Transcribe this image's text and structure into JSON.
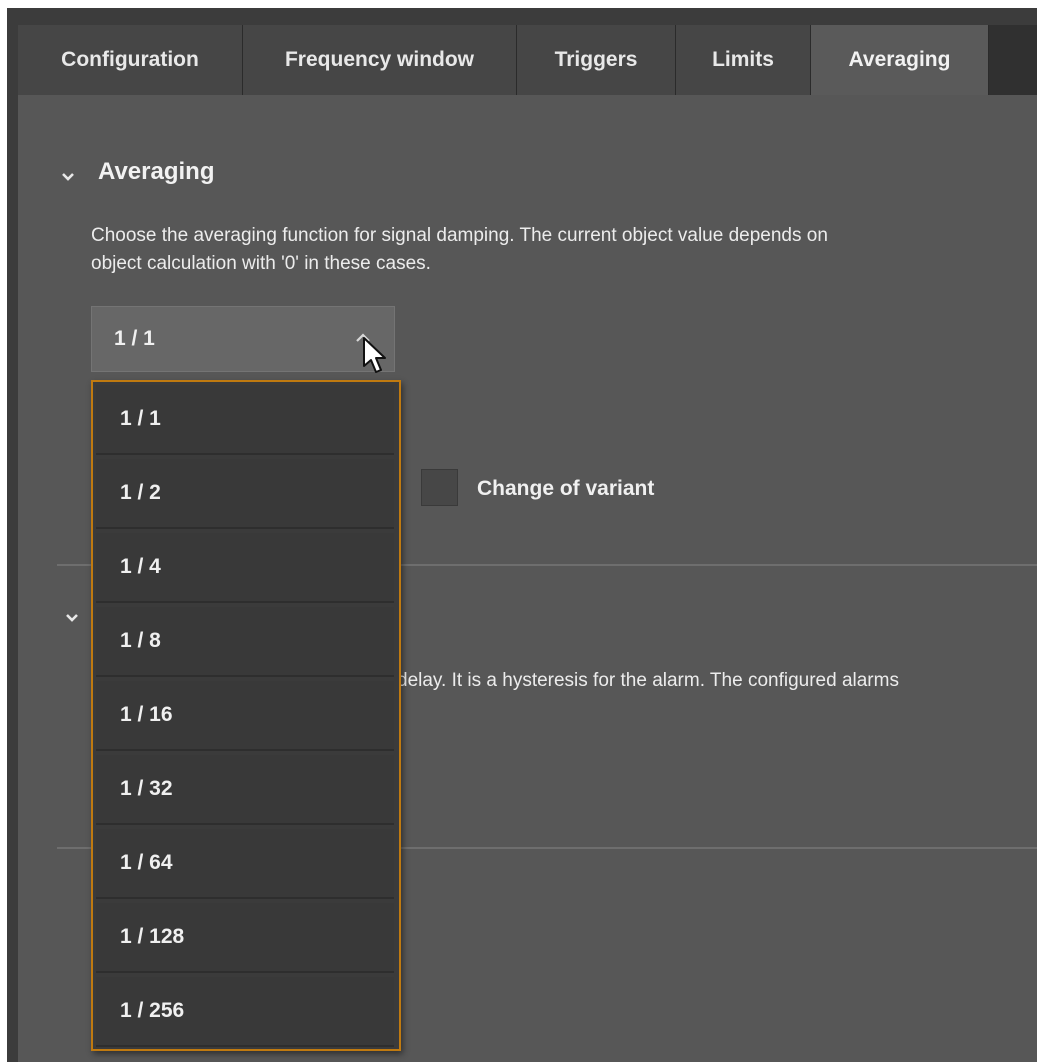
{
  "tabs": [
    {
      "label": "Configuration",
      "active": false
    },
    {
      "label": "Frequency window",
      "active": false
    },
    {
      "label": "Triggers",
      "active": false
    },
    {
      "label": "Limits",
      "active": false
    },
    {
      "label": "Averaging",
      "active": true
    }
  ],
  "section": {
    "title": "Averaging",
    "description_line1": "Choose the averaging function for signal damping. The current object value depends on",
    "description_line2": "object calculation with '0' in these cases."
  },
  "select": {
    "value": "1 / 1",
    "expanded": true,
    "options": [
      "1 / 1",
      "1 / 2",
      "1 / 4",
      "1 / 8",
      "1 / 16",
      "1 / 32",
      "1 / 64",
      "1 / 128",
      "1 / 256"
    ]
  },
  "checkbox": {
    "label": "Change of variant",
    "checked": false
  },
  "section2": {
    "description_fragment": "delay. It is a hysteresis for the alarm. The configured alarms"
  },
  "colors": {
    "dropdown_border": "#c07a10",
    "panel_background": "#575757",
    "tab_active": "#5a5a5a"
  },
  "icons": {
    "section_toggle": "chevron-down-icon",
    "select_toggle": "chevron-up-icon",
    "pointer": "mouse-cursor-icon"
  }
}
